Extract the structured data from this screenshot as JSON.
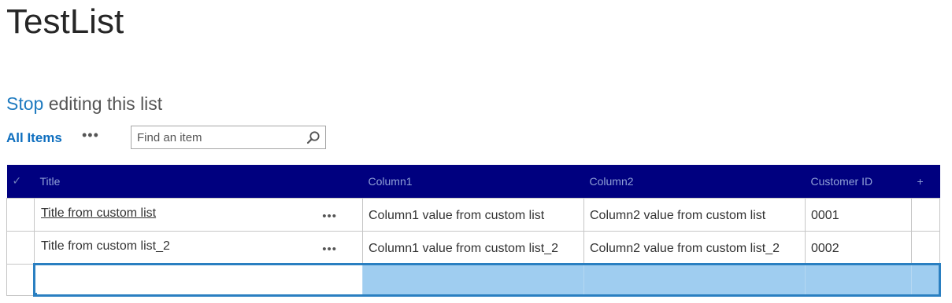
{
  "page": {
    "title": "TestList"
  },
  "edit_mode": {
    "stop_label": "Stop",
    "rest_label": " editing this list"
  },
  "views": {
    "current": "All Items",
    "more_label": "•••"
  },
  "search": {
    "placeholder": "Find an item",
    "value": "",
    "icon": "search-icon"
  },
  "grid": {
    "columns": [
      "Title",
      "Column1",
      "Column2",
      "Customer ID"
    ],
    "add_column_icon": "+",
    "select_all_icon": "✓",
    "row_menu_label": "•••",
    "rows": [
      {
        "title": "Title from custom list",
        "column1": "Column1 value from custom list",
        "column2": "Column2 value from custom list",
        "customer_id": "0001"
      },
      {
        "title": "Title from custom list_2",
        "column1": "Column1 value from custom list_2",
        "column2": "Column2 value from custom list_2",
        "customer_id": "0002"
      }
    ]
  },
  "colors": {
    "header_bg": "#00007f",
    "link": "#0f6fbf",
    "selection": "#9fcdf0",
    "selection_border": "#2a7fc1"
  }
}
